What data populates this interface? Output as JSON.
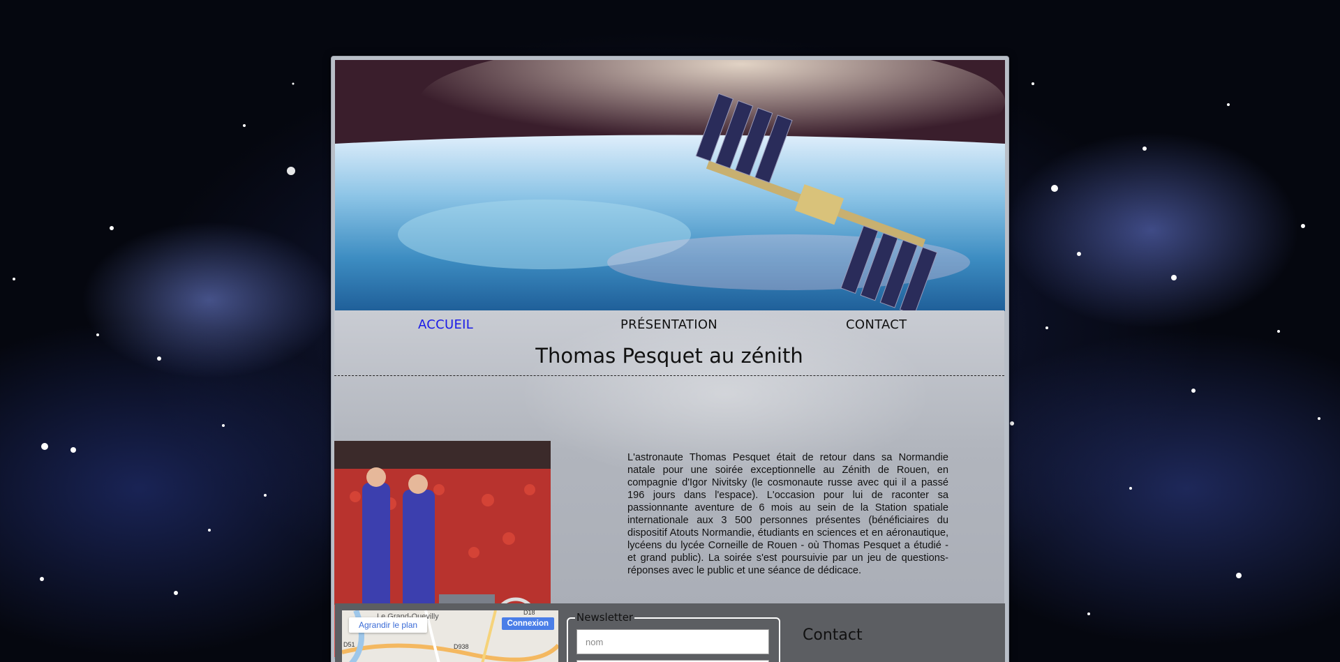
{
  "nav": {
    "items": [
      {
        "label": "ACCUEIL",
        "active": true
      },
      {
        "label": "PRÉSENTATION",
        "active": false
      },
      {
        "label": "CONTACT",
        "active": false
      }
    ]
  },
  "main": {
    "title": "Thomas Pesquet au zénith",
    "article": "L'astronaute Thomas Pesquet était de retour dans sa Normandie natale pour une soirée exceptionnelle au Zénith de Rouen, en compagnie d'Igor Nivitsky (le cosmonaute russe avec qui il a passé 196 jours dans l'espace). L'occasion pour lui de raconter sa passionnante aventure de 6 mois au sein de la Station spatiale internationale aux 3 500 personnes présentes (bénéficiaires du dispositif Atouts Normandie, étudiants en sciences et en aéronautique, lycéens du lycée Corneille de Rouen - où Thomas Pesquet a étudié - et grand public). La soirée s'est poursuivie par un jeu de questions-réponses avec le public et une séance de dédicace."
  },
  "footer": {
    "map": {
      "enlarge_label": "Agrandir le plan",
      "connect_label": "Connexion",
      "place_label": "Le Grand-Quevilly",
      "road_labels": [
        "D18",
        "D938",
        "D51",
        "D938"
      ]
    },
    "newsletter": {
      "legend": "Newsletter",
      "name_placeholder": "nom"
    },
    "contact": {
      "title": "Contact"
    }
  },
  "colors": {
    "nav_active": "#1a1ae8",
    "footer_band": "#5c5e62"
  }
}
